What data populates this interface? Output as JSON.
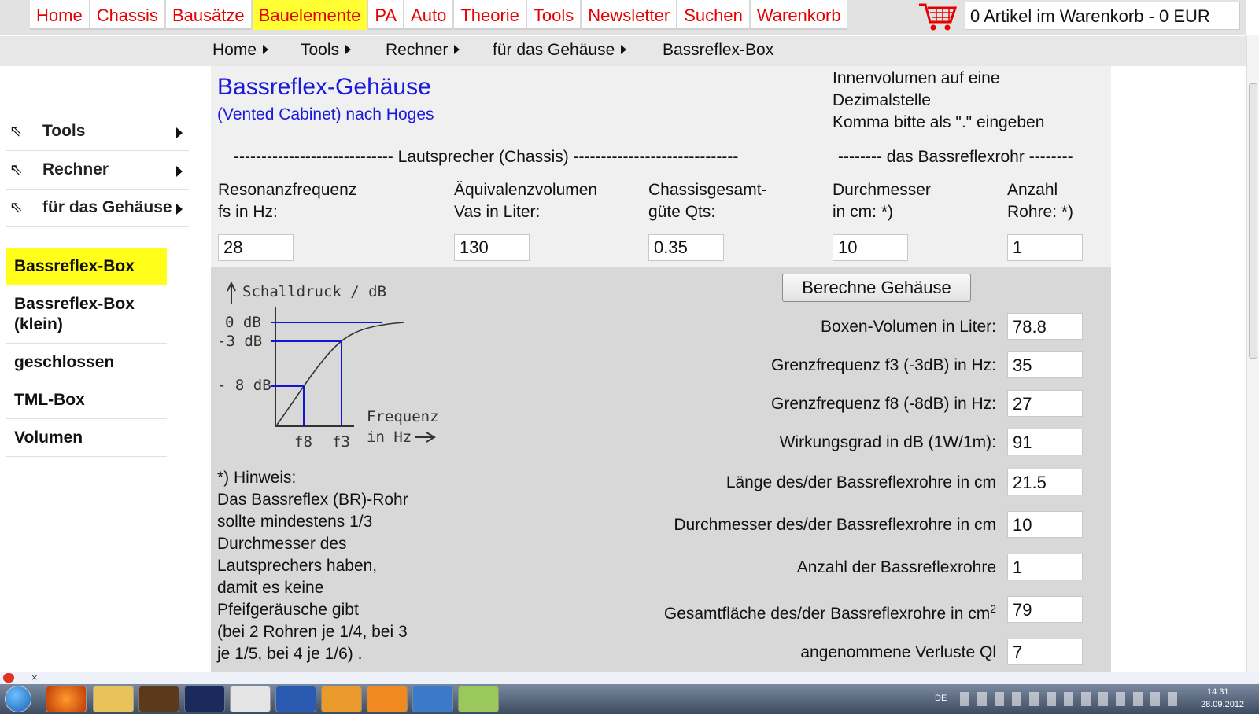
{
  "nav": {
    "items": [
      "Home",
      "Chassis",
      "Bausätze",
      "Bauelemente",
      "PA",
      "Auto",
      "Theorie",
      "Tools",
      "Newsletter",
      "Suchen",
      "Warenkorb"
    ],
    "active": "Bauelemente",
    "cart_text": "0 Artikel im Warenkorb - 0 EUR"
  },
  "breadcrumb": [
    "Home",
    "Tools",
    "Rechner",
    "für das Gehäuse",
    "Bassreflex-Box"
  ],
  "sidebar": {
    "nav": [
      "Tools",
      "Rechner",
      "für das Gehäuse"
    ],
    "links": [
      "Bassreflex-Box",
      "Bassreflex-Box (klein)",
      "geschlossen",
      "TML-Box",
      "Volumen"
    ],
    "active": "Bassreflex-Box"
  },
  "main": {
    "title": "Bassreflex-Gehäuse",
    "subtitle": "(Vented Cabinet) nach Hoges",
    "note": [
      "Innenvolumen auf eine",
      "Dezimalstelle",
      "Komma bitte als \".\" eingeben"
    ],
    "section_chassis": "----------------------------- Lautsprecher (Chassis) ------------------------------",
    "section_rohr": "-------- das Bassreflexrohr --------",
    "inputs": [
      {
        "label1": "Resonanzfrequenz",
        "label2": "fs in Hz:",
        "value": "28"
      },
      {
        "label1": "Äquivalenzvolumen",
        "label2": "Vas in Liter:",
        "value": "130"
      },
      {
        "label1": "Chassisgesamt-",
        "label2": "güte Qts:",
        "value": "0.35"
      },
      {
        "label1": "Durchmesser",
        "label2": "in cm: *)",
        "value": "10"
      },
      {
        "label1": "Anzahl",
        "label2": "Rohre: *)",
        "value": "1"
      }
    ],
    "button": "Berechne Gehäuse",
    "results": [
      {
        "label": "Boxen-Volumen in Liter:",
        "value": "78.8"
      },
      {
        "label": "Grenzfrequenz f3 (-3dB) in Hz:",
        "value": "35"
      },
      {
        "label": "Grenzfrequenz f8 (-8dB) in Hz:",
        "value": "27"
      },
      {
        "label": "Wirkungsgrad in dB (1W/1m):",
        "value": "91"
      },
      {
        "label": "Länge des/der Bassreflexrohre in cm",
        "value": "21.5"
      },
      {
        "label": "Durchmesser des/der Bassreflexrohre in cm",
        "value": "10"
      },
      {
        "label": "Anzahl der Bassreflexrohre",
        "value": "1"
      },
      {
        "label": "Gesamtfläche des/der Bassreflexrohre in cm",
        "sup": "2",
        "value": "79"
      },
      {
        "label": "angenommene Verluste Ql",
        "value": "7"
      }
    ],
    "hint": [
      "*) Hinweis:",
      "Das Bassreflex (BR)-Rohr",
      "sollte mindestens 1/3",
      "Durchmesser des",
      "Lautsprechers haben,",
      "damit es keine",
      "Pfeifgeräusche gibt",
      "(bei 2 Rohren je 1/4, bei 3",
      "je 1/5, bei 4 je 1/6) ."
    ]
  },
  "diagram": {
    "ylabel": "Schalldruck / dB",
    "y_ticks": [
      "0 dB",
      "-3 dB",
      "- 8 dB"
    ],
    "x_ticks": [
      "f8",
      "f3"
    ],
    "xlabel1": "Frequenz",
    "xlabel2": "in Hz"
  },
  "taskbar": {
    "lang": "DE",
    "time": "14:31",
    "date": "28.09.2012"
  },
  "colors": {
    "nav_text": "#e60000",
    "highlight": "#ffff1a",
    "title": "#1a1adb",
    "panel_light": "#f0f0f0",
    "panel_dark": "#d8d8d8"
  }
}
